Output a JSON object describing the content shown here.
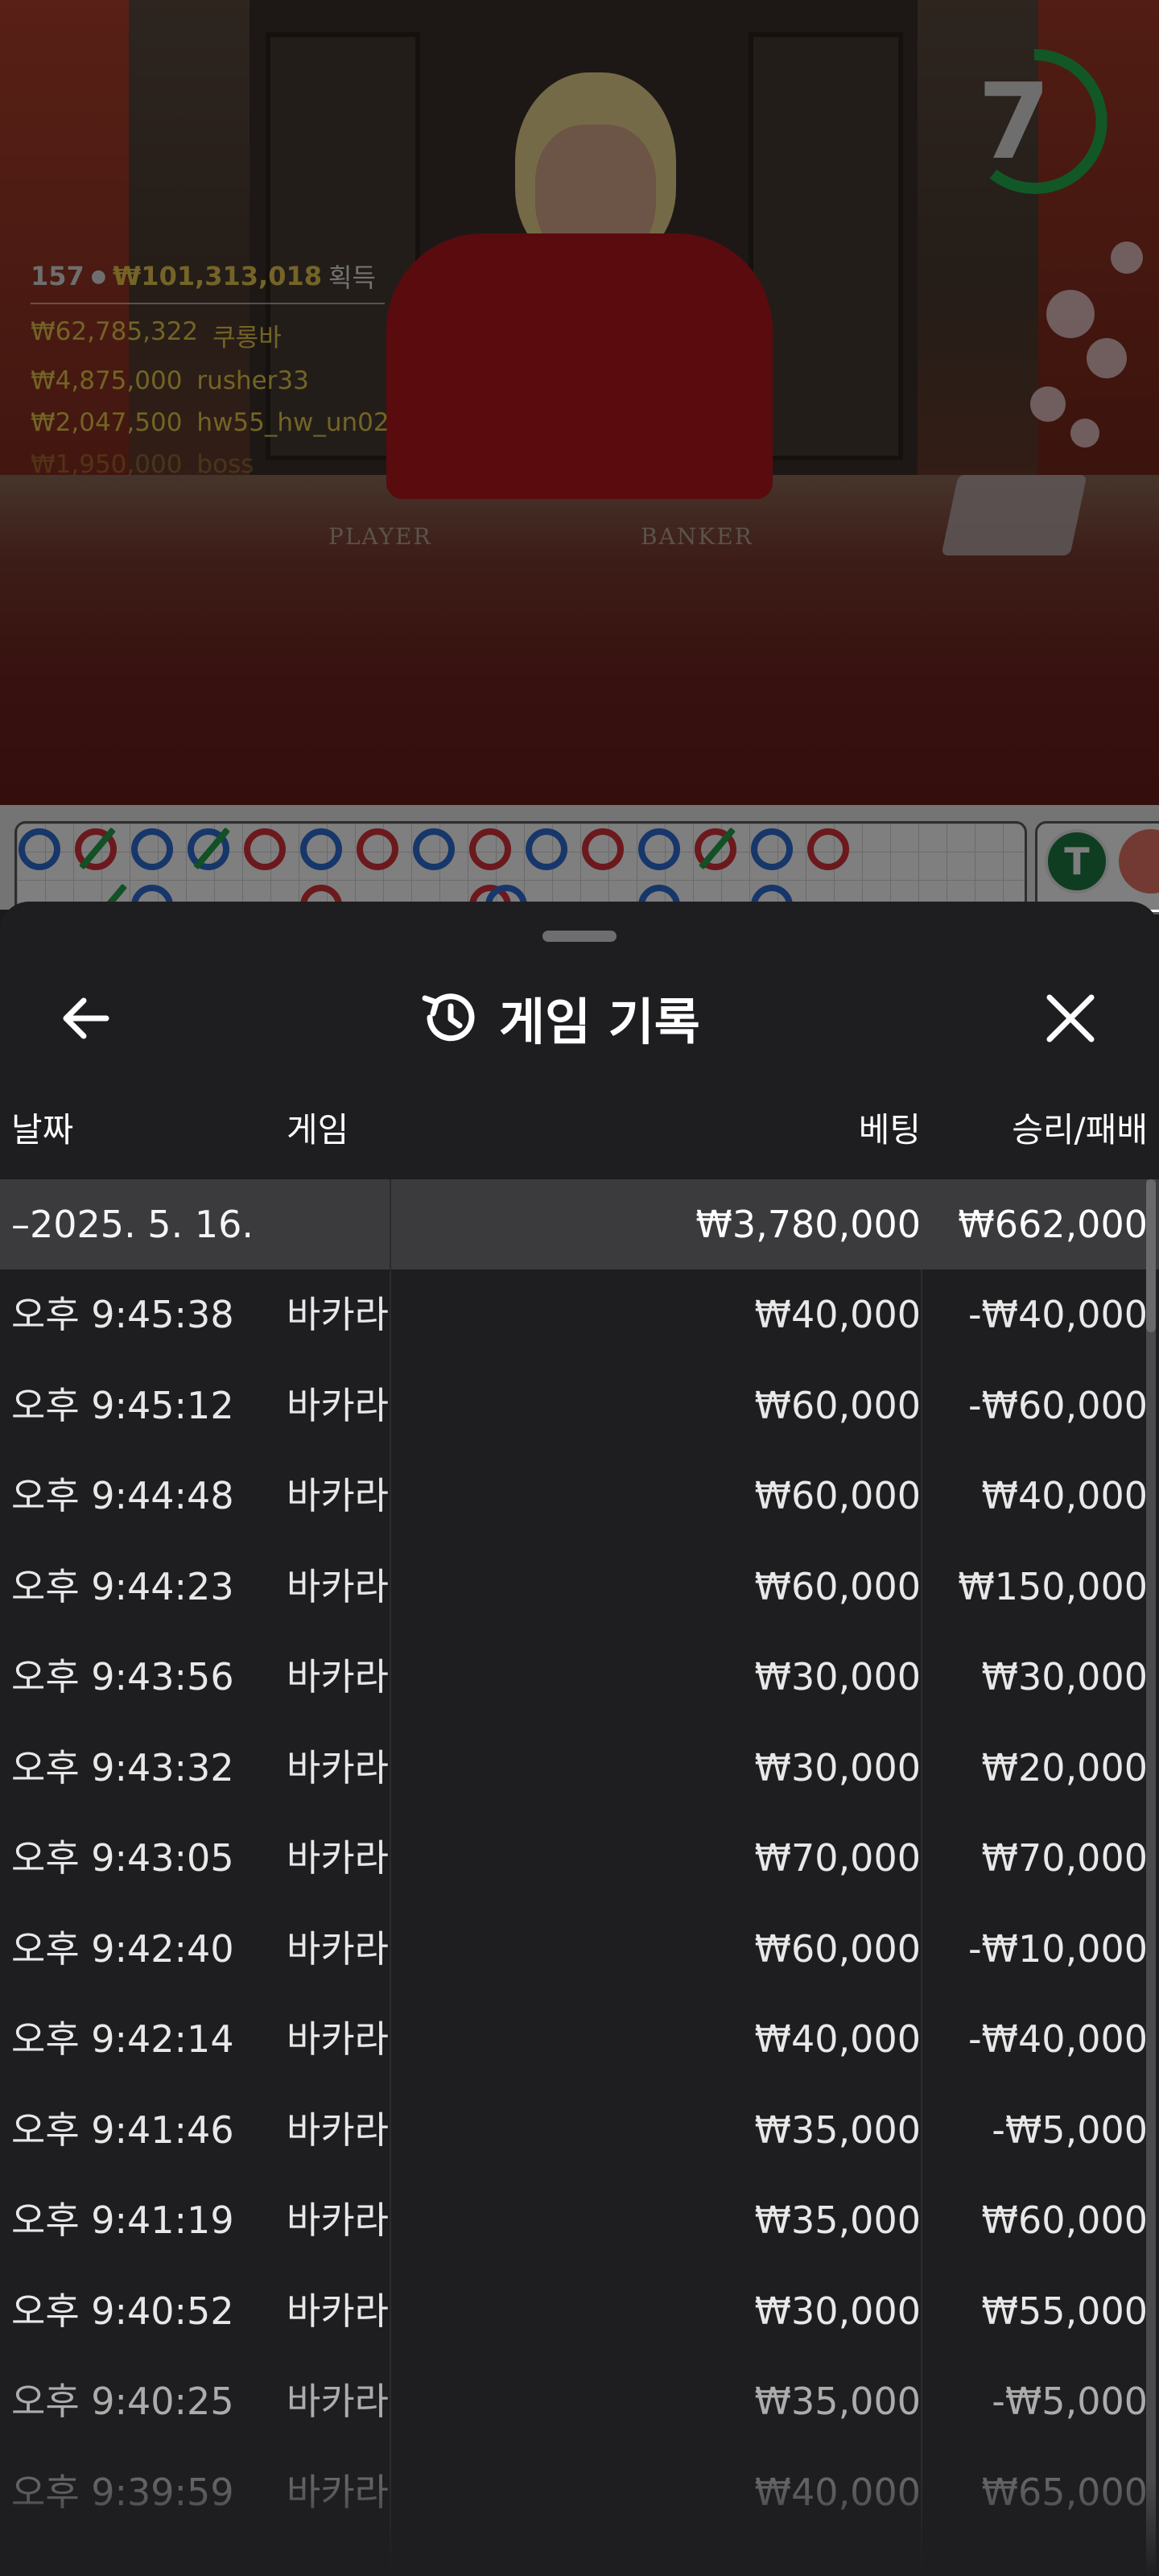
{
  "video": {
    "timer": "7",
    "timer_color": "#22b14c",
    "felt_player": "PLAYER",
    "felt_banker": "BANKER",
    "winners_header": {
      "count": "157",
      "total": "₩101,313,018",
      "label": "획득"
    },
    "winners": [
      {
        "amount": "₩62,785,322",
        "name": "쿠롱바"
      },
      {
        "amount": "₩4,875,000",
        "name": "rusher33"
      },
      {
        "amount": "₩2,047,500",
        "name": "hw55_hw_un02"
      },
      {
        "amount": "₩1,950,000",
        "name": "boss"
      }
    ]
  },
  "roadmap": {
    "player_color": "#2e6fd4",
    "banker_color": "#d6333b",
    "pair_color": "#25a04a",
    "tie_button": "T"
  },
  "sheet": {
    "title": "게임 기록",
    "title_icon": "history-icon",
    "back_icon": "arrow-left-icon",
    "close_icon": "close-icon",
    "columns": {
      "date": "날짜",
      "game": "게임",
      "bet": "베팅",
      "winloss": "승리/패배"
    },
    "summary": {
      "date": "–2025. 5. 16.",
      "bet": "₩3,780,000",
      "winloss": "₩662,000"
    },
    "rows": [
      {
        "time": "오후 9:45:38",
        "game": "바카라",
        "bet": "₩40,000",
        "winloss": "-₩40,000"
      },
      {
        "time": "오후 9:45:12",
        "game": "바카라",
        "bet": "₩60,000",
        "winloss": "-₩60,000"
      },
      {
        "time": "오후 9:44:48",
        "game": "바카라",
        "bet": "₩60,000",
        "winloss": "₩40,000"
      },
      {
        "time": "오후 9:44:23",
        "game": "바카라",
        "bet": "₩60,000",
        "winloss": "₩150,000"
      },
      {
        "time": "오후 9:43:56",
        "game": "바카라",
        "bet": "₩30,000",
        "winloss": "₩30,000"
      },
      {
        "time": "오후 9:43:32",
        "game": "바카라",
        "bet": "₩30,000",
        "winloss": "₩20,000"
      },
      {
        "time": "오후 9:43:05",
        "game": "바카라",
        "bet": "₩70,000",
        "winloss": "₩70,000"
      },
      {
        "time": "오후 9:42:40",
        "game": "바카라",
        "bet": "₩60,000",
        "winloss": "-₩10,000"
      },
      {
        "time": "오후 9:42:14",
        "game": "바카라",
        "bet": "₩40,000",
        "winloss": "-₩40,000"
      },
      {
        "time": "오후 9:41:46",
        "game": "바카라",
        "bet": "₩35,000",
        "winloss": "-₩5,000"
      },
      {
        "time": "오후 9:41:19",
        "game": "바카라",
        "bet": "₩35,000",
        "winloss": "₩60,000"
      },
      {
        "time": "오후 9:40:52",
        "game": "바카라",
        "bet": "₩30,000",
        "winloss": "₩55,000"
      },
      {
        "time": "오후 9:40:25",
        "game": "바카라",
        "bet": "₩35,000",
        "winloss": "-₩5,000"
      },
      {
        "time": "오후 9:39:59",
        "game": "바카라",
        "bet": "₩40,000",
        "winloss": "₩65,000"
      }
    ]
  }
}
